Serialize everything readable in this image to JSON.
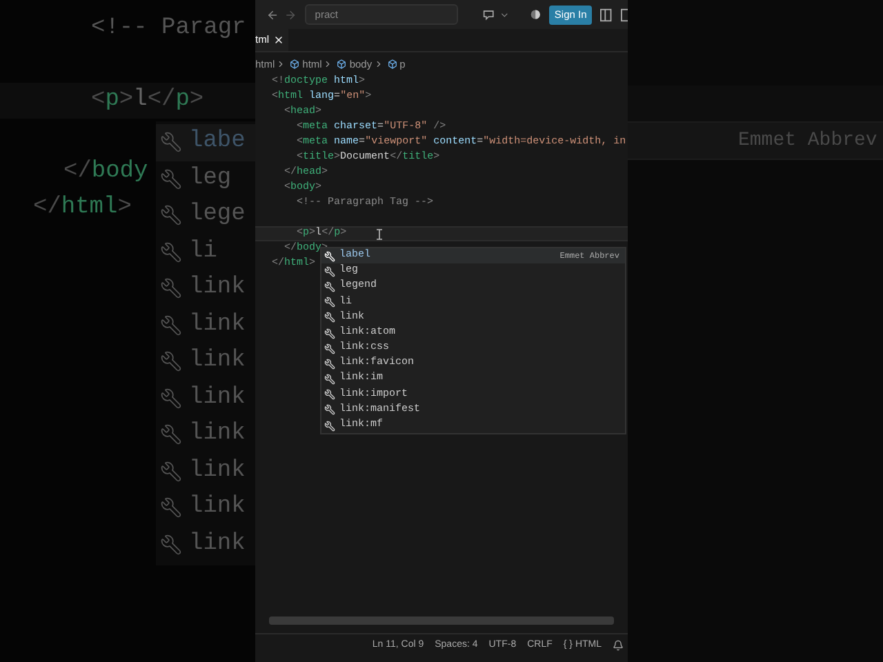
{
  "backdrop": {
    "code_lines": [
      {
        "kind": "code",
        "segments": [
          {
            "text": "<!-- Paragr",
            "kind": "comment"
          }
        ]
      },
      {
        "kind": "blank"
      },
      {
        "kind": "code",
        "segments": [
          {
            "text": "<",
            "kind": "bracket"
          },
          {
            "text": "p",
            "kind": "tag"
          },
          {
            "text": ">",
            "kind": "bracket"
          },
          {
            "text": "l",
            "kind": "text"
          },
          {
            "text": "</",
            "kind": "bracket"
          },
          {
            "text": "p",
            "kind": "tag"
          },
          {
            "text": ">",
            "kind": "bracket"
          }
        ]
      },
      {
        "kind": "blank"
      },
      {
        "kind": "code",
        "segments": [
          {
            "text": "</",
            "kind": "bracket"
          },
          {
            "text": "body",
            "kind": "tag"
          }
        ]
      },
      {
        "kind": "code",
        "segments": [
          {
            "text": "</",
            "kind": "bracket"
          },
          {
            "text": "html",
            "kind": "tag"
          },
          {
            "text": ">",
            "kind": "bracket"
          }
        ]
      }
    ],
    "suggestions": [
      {
        "label": "labe",
        "selected": true
      },
      {
        "label": "leg",
        "selected": false
      },
      {
        "label": "lege",
        "selected": false
      },
      {
        "label": "li",
        "selected": false
      },
      {
        "label": "link",
        "selected": false
      },
      {
        "label": "link",
        "selected": false
      },
      {
        "label": "link",
        "selected": false
      },
      {
        "label": "link",
        "selected": false
      },
      {
        "label": "link",
        "selected": false
      },
      {
        "label": "link",
        "selected": false
      },
      {
        "label": "link",
        "selected": false
      },
      {
        "label": "link",
        "selected": false
      }
    ],
    "detail": "Emmet Abbrev"
  },
  "title_bar": {
    "search": {
      "value": "pract"
    },
    "sign_in": "Sign In"
  },
  "tab": {
    "label": "tml"
  },
  "breadcrumb": [
    "html",
    "html",
    "body",
    "p"
  ],
  "code_lines": [
    {
      "current": false,
      "kind": "code",
      "segments": [
        {
          "text": "<!",
          "kind": "bracket"
        },
        {
          "text": "doctype",
          "kind": "tag"
        },
        {
          "text": " html",
          "kind": "attr"
        },
        {
          "text": ">",
          "kind": "bracket"
        }
      ]
    },
    {
      "current": false,
      "kind": "code",
      "segments": [
        {
          "text": "<",
          "kind": "bracket"
        },
        {
          "text": "html",
          "kind": "tag"
        },
        {
          "text": " lang",
          "kind": "attr"
        },
        {
          "text": "=",
          "kind": "text"
        },
        {
          "text": "\"en\"",
          "kind": "string"
        },
        {
          "text": ">",
          "kind": "bracket"
        }
      ]
    },
    {
      "current": false,
      "kind": "code",
      "segments": [
        {
          "text": "  <",
          "kind": "bracket"
        },
        {
          "text": "head",
          "kind": "tag"
        },
        {
          "text": ">",
          "kind": "bracket"
        }
      ]
    },
    {
      "current": false,
      "kind": "code",
      "segments": [
        {
          "text": "    <",
          "kind": "bracket"
        },
        {
          "text": "meta",
          "kind": "tag"
        },
        {
          "text": " charset",
          "kind": "attr"
        },
        {
          "text": "=",
          "kind": "text"
        },
        {
          "text": "\"UTF-8\"",
          "kind": "string"
        },
        {
          "text": " />",
          "kind": "bracket"
        }
      ]
    },
    {
      "current": false,
      "kind": "code",
      "segments": [
        {
          "text": "    <",
          "kind": "bracket"
        },
        {
          "text": "meta",
          "kind": "tag"
        },
        {
          "text": " name",
          "kind": "attr"
        },
        {
          "text": "=",
          "kind": "text"
        },
        {
          "text": "\"viewport\"",
          "kind": "string"
        },
        {
          "text": " content",
          "kind": "attr"
        },
        {
          "text": "=",
          "kind": "text"
        },
        {
          "text": "\"width=device-width, in",
          "kind": "string"
        }
      ]
    },
    {
      "current": false,
      "kind": "code",
      "segments": [
        {
          "text": "    <",
          "kind": "bracket"
        },
        {
          "text": "title",
          "kind": "tag"
        },
        {
          "text": ">",
          "kind": "bracket"
        },
        {
          "text": "Document",
          "kind": "text"
        },
        {
          "text": "</",
          "kind": "bracket"
        },
        {
          "text": "title",
          "kind": "tag"
        },
        {
          "text": ">",
          "kind": "bracket"
        }
      ]
    },
    {
      "current": false,
      "kind": "code",
      "segments": [
        {
          "text": "  </",
          "kind": "bracket"
        },
        {
          "text": "head",
          "kind": "tag"
        },
        {
          "text": ">",
          "kind": "bracket"
        }
      ]
    },
    {
      "current": false,
      "kind": "code",
      "segments": [
        {
          "text": "  <",
          "kind": "bracket"
        },
        {
          "text": "body",
          "kind": "tag"
        },
        {
          "text": ">",
          "kind": "bracket"
        }
      ]
    },
    {
      "current": false,
      "kind": "code",
      "segments": [
        {
          "text": "    <!-- Paragraph Tag -->",
          "kind": "comment"
        }
      ]
    },
    {
      "current": false,
      "kind": "blank"
    },
    {
      "current": true,
      "kind": "code",
      "segments": [
        {
          "text": "    <",
          "kind": "bracket"
        },
        {
          "text": "p",
          "kind": "tag"
        },
        {
          "text": ">",
          "kind": "bracket"
        },
        {
          "text": "l",
          "kind": "text"
        },
        {
          "text": "</",
          "kind": "bracket"
        },
        {
          "text": "p",
          "kind": "tag"
        },
        {
          "text": ">",
          "kind": "bracket"
        }
      ]
    },
    {
      "current": false,
      "kind": "code",
      "segments": [
        {
          "text": "  </",
          "kind": "bracket"
        },
        {
          "text": "body",
          "kind": "tag"
        },
        {
          "text": ">",
          "kind": "bracket"
        }
      ]
    },
    {
      "current": false,
      "kind": "code",
      "segments": [
        {
          "text": "</",
          "kind": "bracket"
        },
        {
          "text": "html",
          "kind": "tag"
        },
        {
          "text": ">",
          "kind": "bracket"
        }
      ]
    }
  ],
  "suggestions": [
    {
      "label": "label",
      "selected": true,
      "detail": "Emmet Abbrev"
    },
    {
      "label": "leg",
      "selected": false
    },
    {
      "label": "legend",
      "selected": false
    },
    {
      "label": "li",
      "selected": false
    },
    {
      "label": "link",
      "selected": false
    },
    {
      "label": "link:atom",
      "selected": false
    },
    {
      "label": "link:css",
      "selected": false
    },
    {
      "label": "link:favicon",
      "selected": false
    },
    {
      "label": "link:im",
      "selected": false
    },
    {
      "label": "link:import",
      "selected": false
    },
    {
      "label": "link:manifest",
      "selected": false
    },
    {
      "label": "link:mf",
      "selected": false
    }
  ],
  "status_bar": [
    "Ln 11, Col 9",
    "Spaces: 4",
    "UTF-8",
    "CRLF",
    "{ } HTML"
  ]
}
